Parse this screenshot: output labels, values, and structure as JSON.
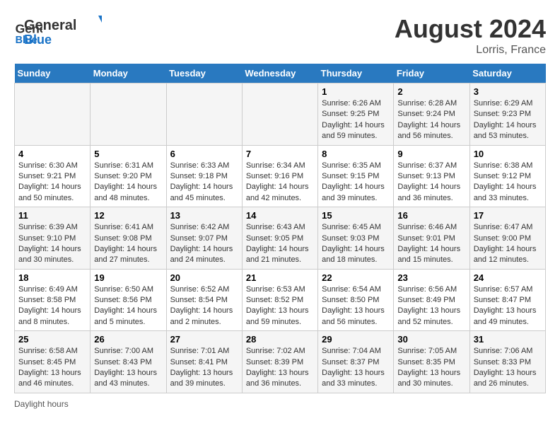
{
  "header": {
    "logo_line1": "General",
    "logo_line2": "Blue",
    "month_title": "August 2024",
    "location": "Lorris, France"
  },
  "days_of_week": [
    "Sunday",
    "Monday",
    "Tuesday",
    "Wednesday",
    "Thursday",
    "Friday",
    "Saturday"
  ],
  "weeks": [
    [
      {
        "num": "",
        "sunrise": "",
        "sunset": "",
        "daylight": ""
      },
      {
        "num": "",
        "sunrise": "",
        "sunset": "",
        "daylight": ""
      },
      {
        "num": "",
        "sunrise": "",
        "sunset": "",
        "daylight": ""
      },
      {
        "num": "",
        "sunrise": "",
        "sunset": "",
        "daylight": ""
      },
      {
        "num": "1",
        "sunrise": "Sunrise: 6:26 AM",
        "sunset": "Sunset: 9:25 PM",
        "daylight": "Daylight: 14 hours and 59 minutes."
      },
      {
        "num": "2",
        "sunrise": "Sunrise: 6:28 AM",
        "sunset": "Sunset: 9:24 PM",
        "daylight": "Daylight: 14 hours and 56 minutes."
      },
      {
        "num": "3",
        "sunrise": "Sunrise: 6:29 AM",
        "sunset": "Sunset: 9:23 PM",
        "daylight": "Daylight: 14 hours and 53 minutes."
      }
    ],
    [
      {
        "num": "4",
        "sunrise": "Sunrise: 6:30 AM",
        "sunset": "Sunset: 9:21 PM",
        "daylight": "Daylight: 14 hours and 50 minutes."
      },
      {
        "num": "5",
        "sunrise": "Sunrise: 6:31 AM",
        "sunset": "Sunset: 9:20 PM",
        "daylight": "Daylight: 14 hours and 48 minutes."
      },
      {
        "num": "6",
        "sunrise": "Sunrise: 6:33 AM",
        "sunset": "Sunset: 9:18 PM",
        "daylight": "Daylight: 14 hours and 45 minutes."
      },
      {
        "num": "7",
        "sunrise": "Sunrise: 6:34 AM",
        "sunset": "Sunset: 9:16 PM",
        "daylight": "Daylight: 14 hours and 42 minutes."
      },
      {
        "num": "8",
        "sunrise": "Sunrise: 6:35 AM",
        "sunset": "Sunset: 9:15 PM",
        "daylight": "Daylight: 14 hours and 39 minutes."
      },
      {
        "num": "9",
        "sunrise": "Sunrise: 6:37 AM",
        "sunset": "Sunset: 9:13 PM",
        "daylight": "Daylight: 14 hours and 36 minutes."
      },
      {
        "num": "10",
        "sunrise": "Sunrise: 6:38 AM",
        "sunset": "Sunset: 9:12 PM",
        "daylight": "Daylight: 14 hours and 33 minutes."
      }
    ],
    [
      {
        "num": "11",
        "sunrise": "Sunrise: 6:39 AM",
        "sunset": "Sunset: 9:10 PM",
        "daylight": "Daylight: 14 hours and 30 minutes."
      },
      {
        "num": "12",
        "sunrise": "Sunrise: 6:41 AM",
        "sunset": "Sunset: 9:08 PM",
        "daylight": "Daylight: 14 hours and 27 minutes."
      },
      {
        "num": "13",
        "sunrise": "Sunrise: 6:42 AM",
        "sunset": "Sunset: 9:07 PM",
        "daylight": "Daylight: 14 hours and 24 minutes."
      },
      {
        "num": "14",
        "sunrise": "Sunrise: 6:43 AM",
        "sunset": "Sunset: 9:05 PM",
        "daylight": "Daylight: 14 hours and 21 minutes."
      },
      {
        "num": "15",
        "sunrise": "Sunrise: 6:45 AM",
        "sunset": "Sunset: 9:03 PM",
        "daylight": "Daylight: 14 hours and 18 minutes."
      },
      {
        "num": "16",
        "sunrise": "Sunrise: 6:46 AM",
        "sunset": "Sunset: 9:01 PM",
        "daylight": "Daylight: 14 hours and 15 minutes."
      },
      {
        "num": "17",
        "sunrise": "Sunrise: 6:47 AM",
        "sunset": "Sunset: 9:00 PM",
        "daylight": "Daylight: 14 hours and 12 minutes."
      }
    ],
    [
      {
        "num": "18",
        "sunrise": "Sunrise: 6:49 AM",
        "sunset": "Sunset: 8:58 PM",
        "daylight": "Daylight: 14 hours and 8 minutes."
      },
      {
        "num": "19",
        "sunrise": "Sunrise: 6:50 AM",
        "sunset": "Sunset: 8:56 PM",
        "daylight": "Daylight: 14 hours and 5 minutes."
      },
      {
        "num": "20",
        "sunrise": "Sunrise: 6:52 AM",
        "sunset": "Sunset: 8:54 PM",
        "daylight": "Daylight: 14 hours and 2 minutes."
      },
      {
        "num": "21",
        "sunrise": "Sunrise: 6:53 AM",
        "sunset": "Sunset: 8:52 PM",
        "daylight": "Daylight: 13 hours and 59 minutes."
      },
      {
        "num": "22",
        "sunrise": "Sunrise: 6:54 AM",
        "sunset": "Sunset: 8:50 PM",
        "daylight": "Daylight: 13 hours and 56 minutes."
      },
      {
        "num": "23",
        "sunrise": "Sunrise: 6:56 AM",
        "sunset": "Sunset: 8:49 PM",
        "daylight": "Daylight: 13 hours and 52 minutes."
      },
      {
        "num": "24",
        "sunrise": "Sunrise: 6:57 AM",
        "sunset": "Sunset: 8:47 PM",
        "daylight": "Daylight: 13 hours and 49 minutes."
      }
    ],
    [
      {
        "num": "25",
        "sunrise": "Sunrise: 6:58 AM",
        "sunset": "Sunset: 8:45 PM",
        "daylight": "Daylight: 13 hours and 46 minutes."
      },
      {
        "num": "26",
        "sunrise": "Sunrise: 7:00 AM",
        "sunset": "Sunset: 8:43 PM",
        "daylight": "Daylight: 13 hours and 43 minutes."
      },
      {
        "num": "27",
        "sunrise": "Sunrise: 7:01 AM",
        "sunset": "Sunset: 8:41 PM",
        "daylight": "Daylight: 13 hours and 39 minutes."
      },
      {
        "num": "28",
        "sunrise": "Sunrise: 7:02 AM",
        "sunset": "Sunset: 8:39 PM",
        "daylight": "Daylight: 13 hours and 36 minutes."
      },
      {
        "num": "29",
        "sunrise": "Sunrise: 7:04 AM",
        "sunset": "Sunset: 8:37 PM",
        "daylight": "Daylight: 13 hours and 33 minutes."
      },
      {
        "num": "30",
        "sunrise": "Sunrise: 7:05 AM",
        "sunset": "Sunset: 8:35 PM",
        "daylight": "Daylight: 13 hours and 30 minutes."
      },
      {
        "num": "31",
        "sunrise": "Sunrise: 7:06 AM",
        "sunset": "Sunset: 8:33 PM",
        "daylight": "Daylight: 13 hours and 26 minutes."
      }
    ]
  ],
  "footer": "Daylight hours"
}
